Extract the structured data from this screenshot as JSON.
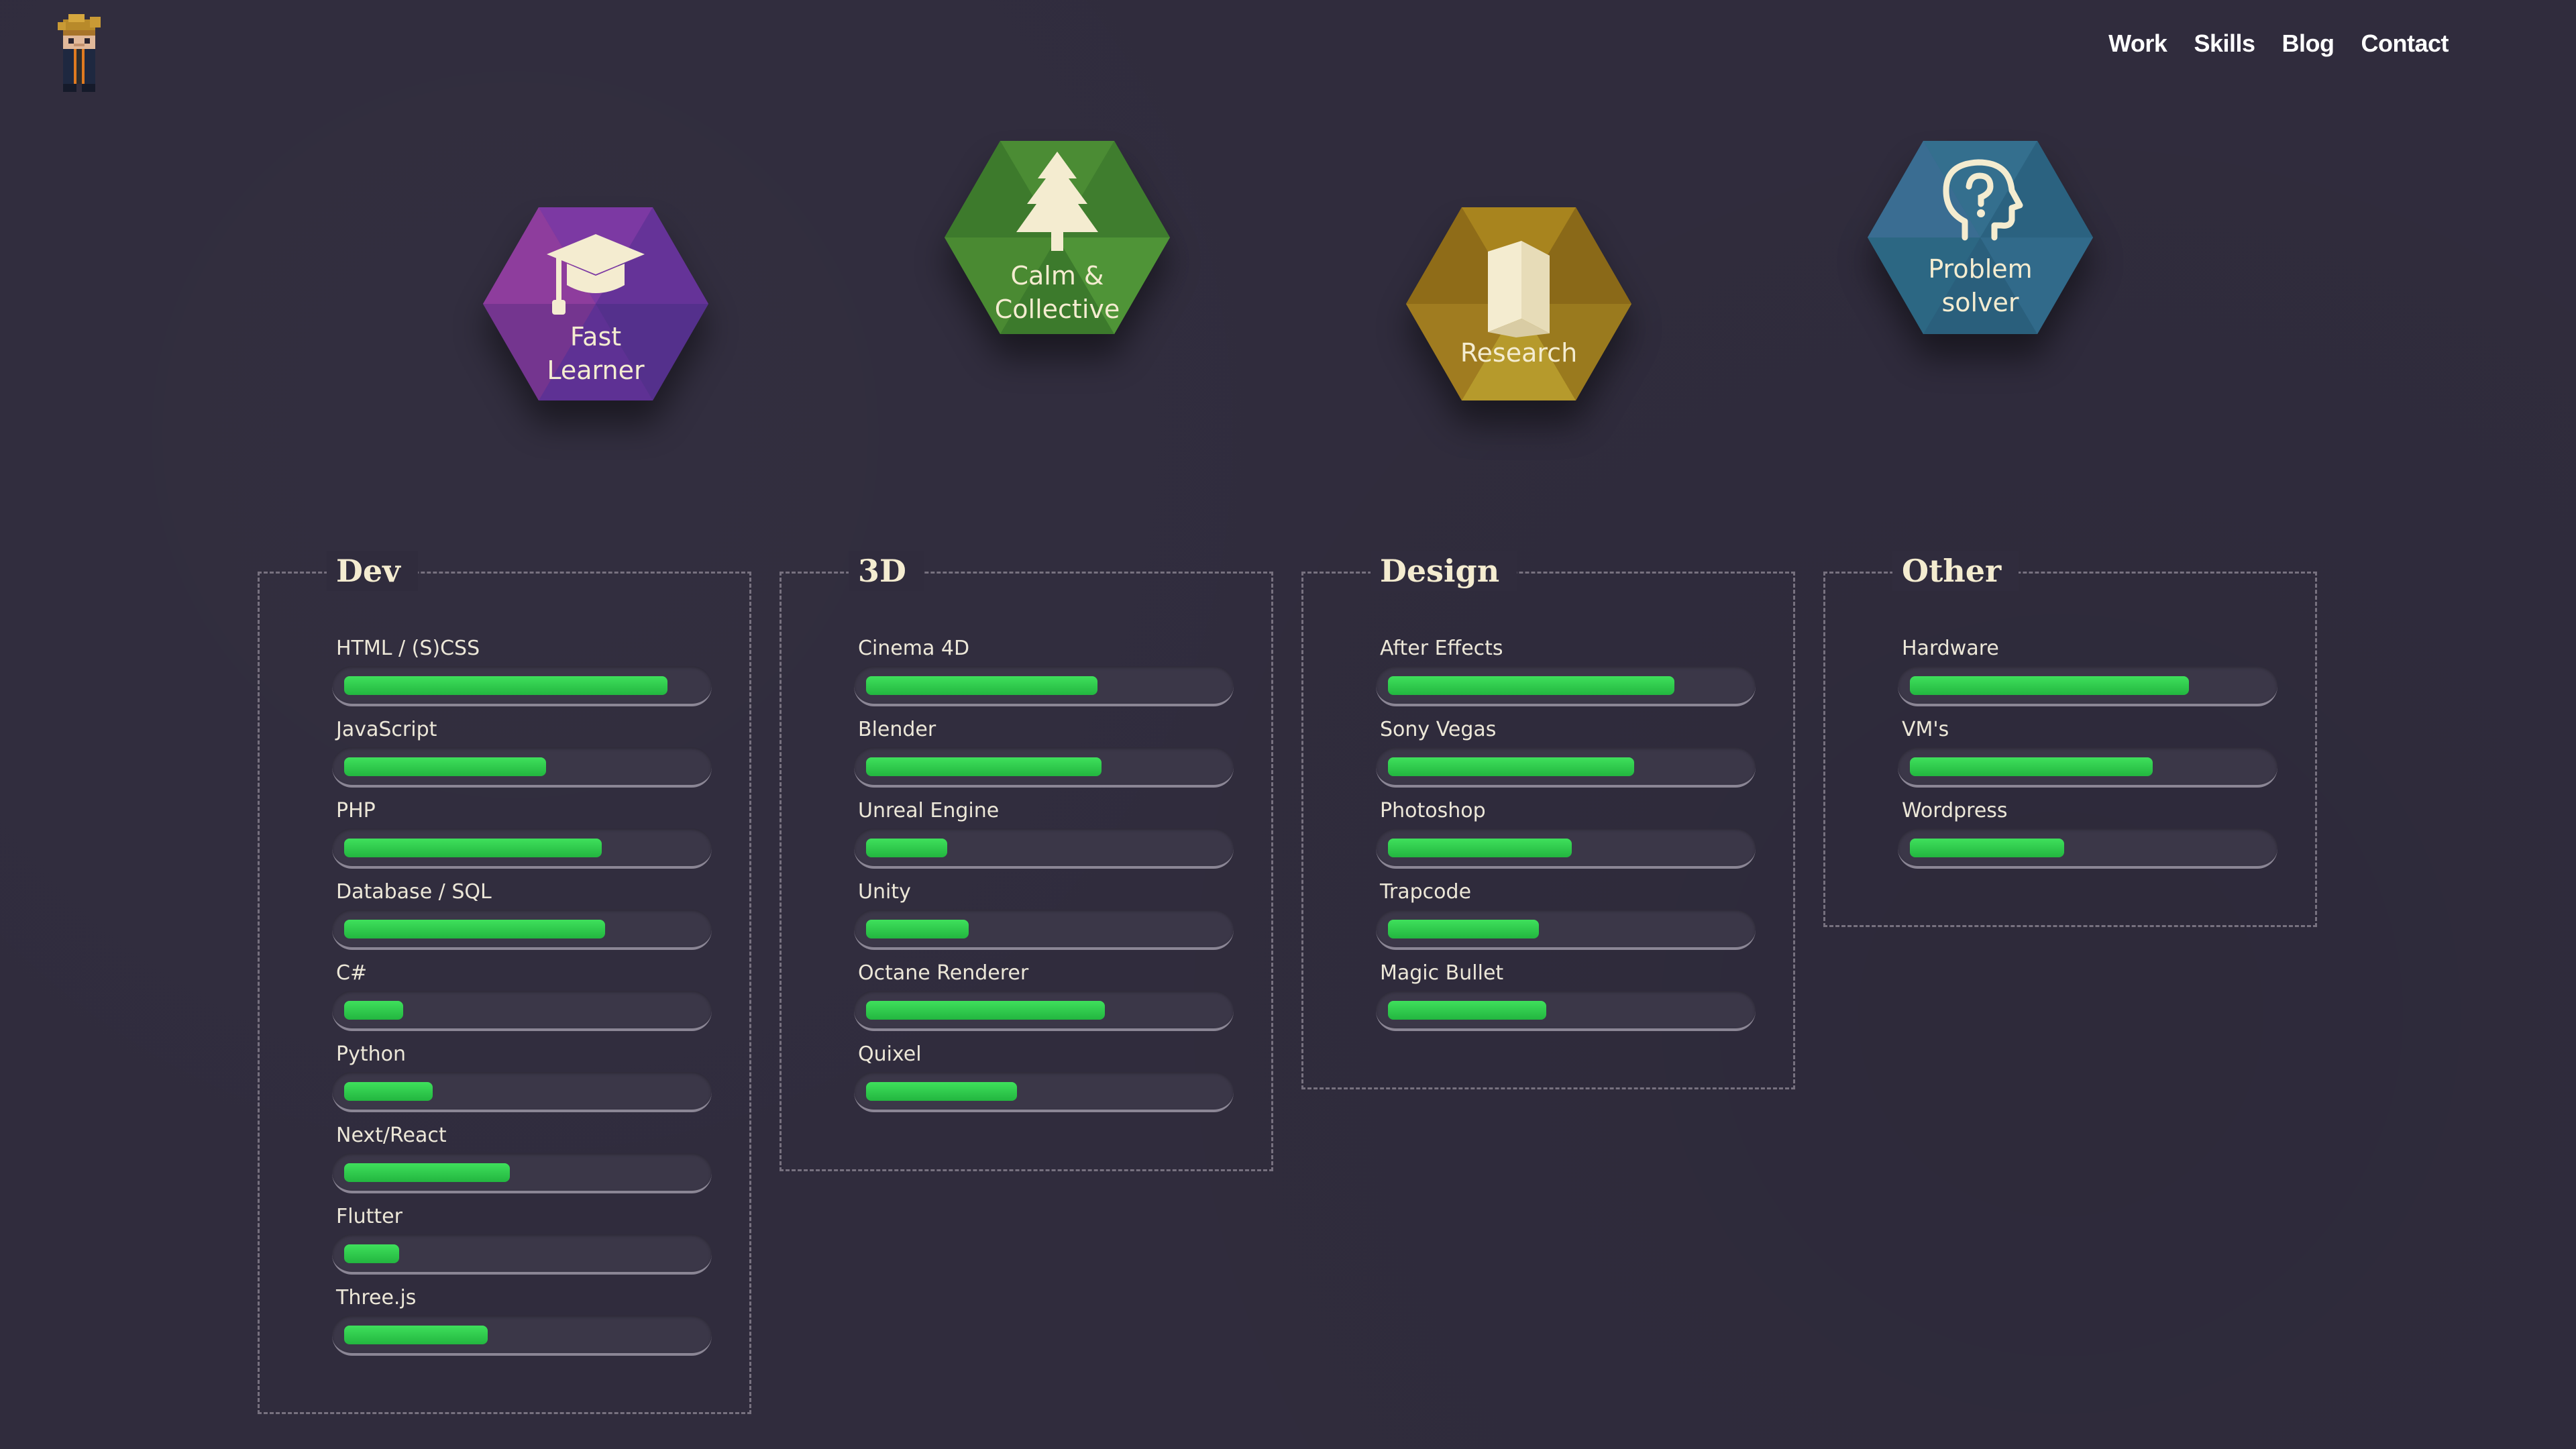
{
  "nav": {
    "items": [
      "Work",
      "Skills",
      "Blog",
      "Contact"
    ]
  },
  "traits": [
    {
      "label": "Fast\nLearner",
      "icon": "graduation-cap-icon",
      "color": "#7b3a9c"
    },
    {
      "label": "Calm &\nCollective",
      "icon": "tree-icon",
      "color": "#4a8a35"
    },
    {
      "label": "Research",
      "icon": "book-icon",
      "color": "#a9811e"
    },
    {
      "label": "Problem\nsolver",
      "icon": "head-question-icon",
      "color": "#2f6e8c"
    }
  ],
  "groups": [
    {
      "title": "Dev",
      "skills": [
        {
          "name": "HTML / (S)CSS",
          "level": 0.88
        },
        {
          "name": "JavaScript",
          "level": 0.55
        },
        {
          "name": "PHP",
          "level": 0.7
        },
        {
          "name": "Database / SQL",
          "level": 0.71
        },
        {
          "name": "C#",
          "level": 0.16
        },
        {
          "name": "Python",
          "level": 0.24
        },
        {
          "name": "Next/React",
          "level": 0.45
        },
        {
          "name": "Flutter",
          "level": 0.15
        },
        {
          "name": "Three.js",
          "level": 0.39
        }
      ]
    },
    {
      "title": "3D",
      "skills": [
        {
          "name": "Cinema 4D",
          "level": 0.63
        },
        {
          "name": "Blender",
          "level": 0.64
        },
        {
          "name": "Unreal Engine",
          "level": 0.22
        },
        {
          "name": "Unity",
          "level": 0.28
        },
        {
          "name": "Octane Renderer",
          "level": 0.65
        },
        {
          "name": "Quixel",
          "level": 0.41
        }
      ]
    },
    {
      "title": "Design",
      "skills": [
        {
          "name": "After Effects",
          "level": 0.78
        },
        {
          "name": "Sony Vegas",
          "level": 0.67
        },
        {
          "name": "Photoshop",
          "level": 0.5
        },
        {
          "name": "Trapcode",
          "level": 0.41
        },
        {
          "name": "Magic Bullet",
          "level": 0.43
        }
      ]
    },
    {
      "title": "Other",
      "skills": [
        {
          "name": "Hardware",
          "level": 0.76
        },
        {
          "name": "VM's",
          "level": 0.66
        },
        {
          "name": "Wordpress",
          "level": 0.42
        }
      ]
    }
  ]
}
